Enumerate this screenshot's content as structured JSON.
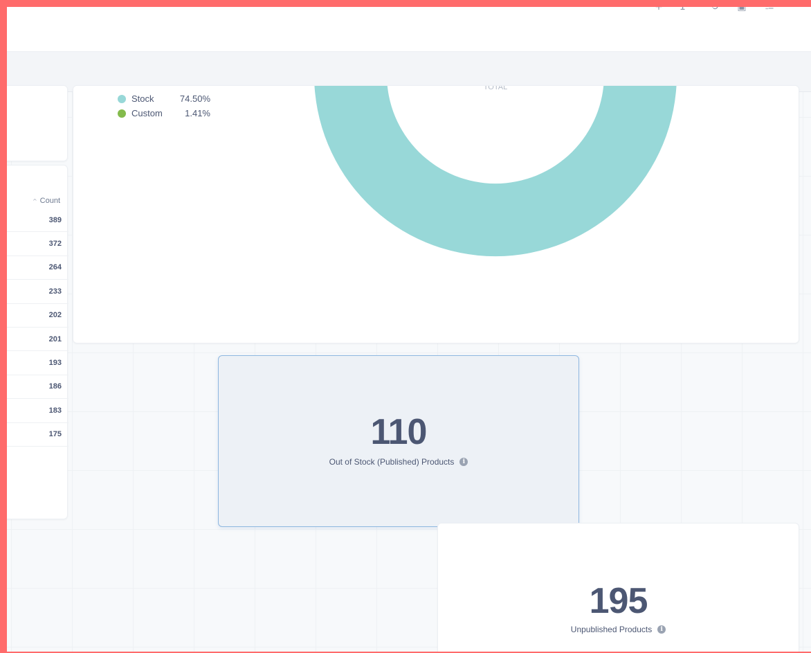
{
  "toolbar": {
    "icons": [
      "plus-icon",
      "filter-icon",
      "clock-icon",
      "bookmark-icon",
      "chart-icon",
      "more-icon"
    ],
    "glyphs": [
      "+",
      "1 ˅",
      "⟲",
      "▣",
      "⩴",
      "···"
    ]
  },
  "donut_card": {
    "center_label": "TOTAL",
    "legend": [
      {
        "label": "Stock",
        "percent": "74.50%",
        "color": "#98d8d8"
      },
      {
        "label": "Custom",
        "percent": "1.41%",
        "color": "#84bb4c"
      }
    ]
  },
  "count_table": {
    "header": "Count",
    "rows": [
      "389",
      "372",
      "264",
      "233",
      "202",
      "201",
      "193",
      "186",
      "183",
      "175"
    ]
  },
  "metrics": {
    "out_of_stock": {
      "value": "110",
      "label": "Out of Stock (Published) Products"
    },
    "unpublished": {
      "value": "195",
      "label": "Unpublished Products"
    }
  },
  "chart_data": {
    "type": "pie",
    "categories": [
      "Stock",
      "Custom"
    ],
    "values": [
      74.5,
      1.41
    ],
    "title": "",
    "center_label": "TOTAL"
  }
}
